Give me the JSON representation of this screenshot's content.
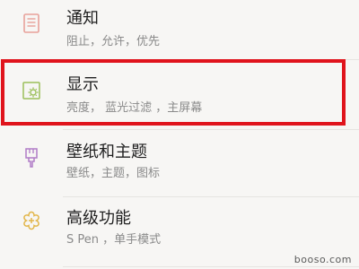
{
  "settings": {
    "items": [
      {
        "icon": "notification-icon",
        "title": "通知",
        "subtitle": "阻止，允许，优先"
      },
      {
        "icon": "display-icon",
        "title": "显示",
        "subtitle": "亮度，  蓝光过滤  ，主屏幕"
      },
      {
        "icon": "brush-icon",
        "title": "壁纸和主题",
        "subtitle": "壁纸，主题，图标"
      },
      {
        "icon": "advanced-features-icon",
        "title": "高级功能",
        "subtitle": "S Pen  ，单手模式"
      }
    ]
  },
  "colors": {
    "highlight_border": "#e0141c",
    "notification_icon": "#e8a19a",
    "display_icon": "#9bbf5a",
    "brush_icon": "#b07cc6",
    "advanced_icon": "#e2b64a"
  },
  "watermark": "booso.com"
}
